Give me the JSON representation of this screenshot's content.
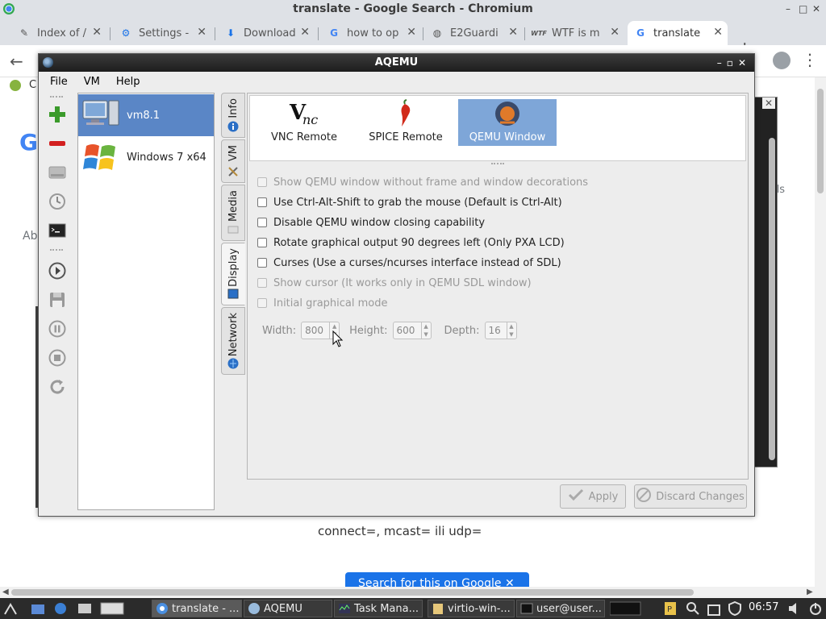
{
  "chrome": {
    "title": "translate - Google Search - Chromium",
    "tabs": [
      {
        "label": "Index of /",
        "icon": "puzzle-icon"
      },
      {
        "label": "Settings -",
        "icon": "gear-icon"
      },
      {
        "label": "Download",
        "icon": "download-icon"
      },
      {
        "label": "how to op",
        "icon": "google-icon"
      },
      {
        "label": "E2Guardi",
        "icon": "globe-icon"
      },
      {
        "label": "WTF is m",
        "icon": "wtf-icon"
      },
      {
        "label": "translate",
        "icon": "google-icon"
      }
    ],
    "bookmark_label": "C",
    "logo_partial": "G",
    "about_partial": "Abo",
    "side_partial": "ds",
    "page_text": "connect=, mcast= ili udp=",
    "search_button": "Search for this on Google"
  },
  "aqemu": {
    "title": "AQEMU",
    "menu": [
      "File",
      "VM",
      "Help"
    ],
    "vm_list": [
      {
        "name": "vm8.1",
        "selected": true
      },
      {
        "name": "Windows 7 x64",
        "selected": false
      }
    ],
    "side_tabs": [
      {
        "label": "Info"
      },
      {
        "label": "VM"
      },
      {
        "label": "Media"
      },
      {
        "label": "Display",
        "active": true
      },
      {
        "label": "Network"
      }
    ],
    "modes": [
      {
        "label": "VNC Remote"
      },
      {
        "label": "SPICE Remote"
      },
      {
        "label": "QEMU Window",
        "selected": true
      }
    ],
    "options": [
      {
        "label": "Show QEMU window without frame and window decorations",
        "enabled": false,
        "checked": false
      },
      {
        "label": "Use Ctrl-Alt-Shift to grab the mouse (Default is Ctrl-Alt)",
        "enabled": true,
        "checked": false
      },
      {
        "label": "Disable QEMU window closing capability",
        "enabled": true,
        "checked": false
      },
      {
        "label": "Rotate graphical output 90 degrees left (Only PXA LCD)",
        "enabled": true,
        "checked": false
      },
      {
        "label": "Curses (Use a curses/ncurses interface instead of SDL)",
        "enabled": true,
        "checked": false
      },
      {
        "label": "Show cursor (It works only in QEMU SDL window)",
        "enabled": false,
        "checked": false
      },
      {
        "label": "Initial graphical mode",
        "enabled": false,
        "checked": false
      }
    ],
    "width_label": "Width:",
    "width_value": "800",
    "height_label": "Height:",
    "height_value": "600",
    "depth_label": "Depth:",
    "depth_value": "16",
    "apply": "Apply",
    "discard": "Discard Changes"
  },
  "taskbar": {
    "tasks": [
      {
        "label": "translate - ..."
      },
      {
        "label": "AQEMU"
      },
      {
        "label": "Task Mana..."
      },
      {
        "label": "virtio-win-..."
      },
      {
        "label": "user@user..."
      }
    ],
    "clock": "06:57"
  }
}
